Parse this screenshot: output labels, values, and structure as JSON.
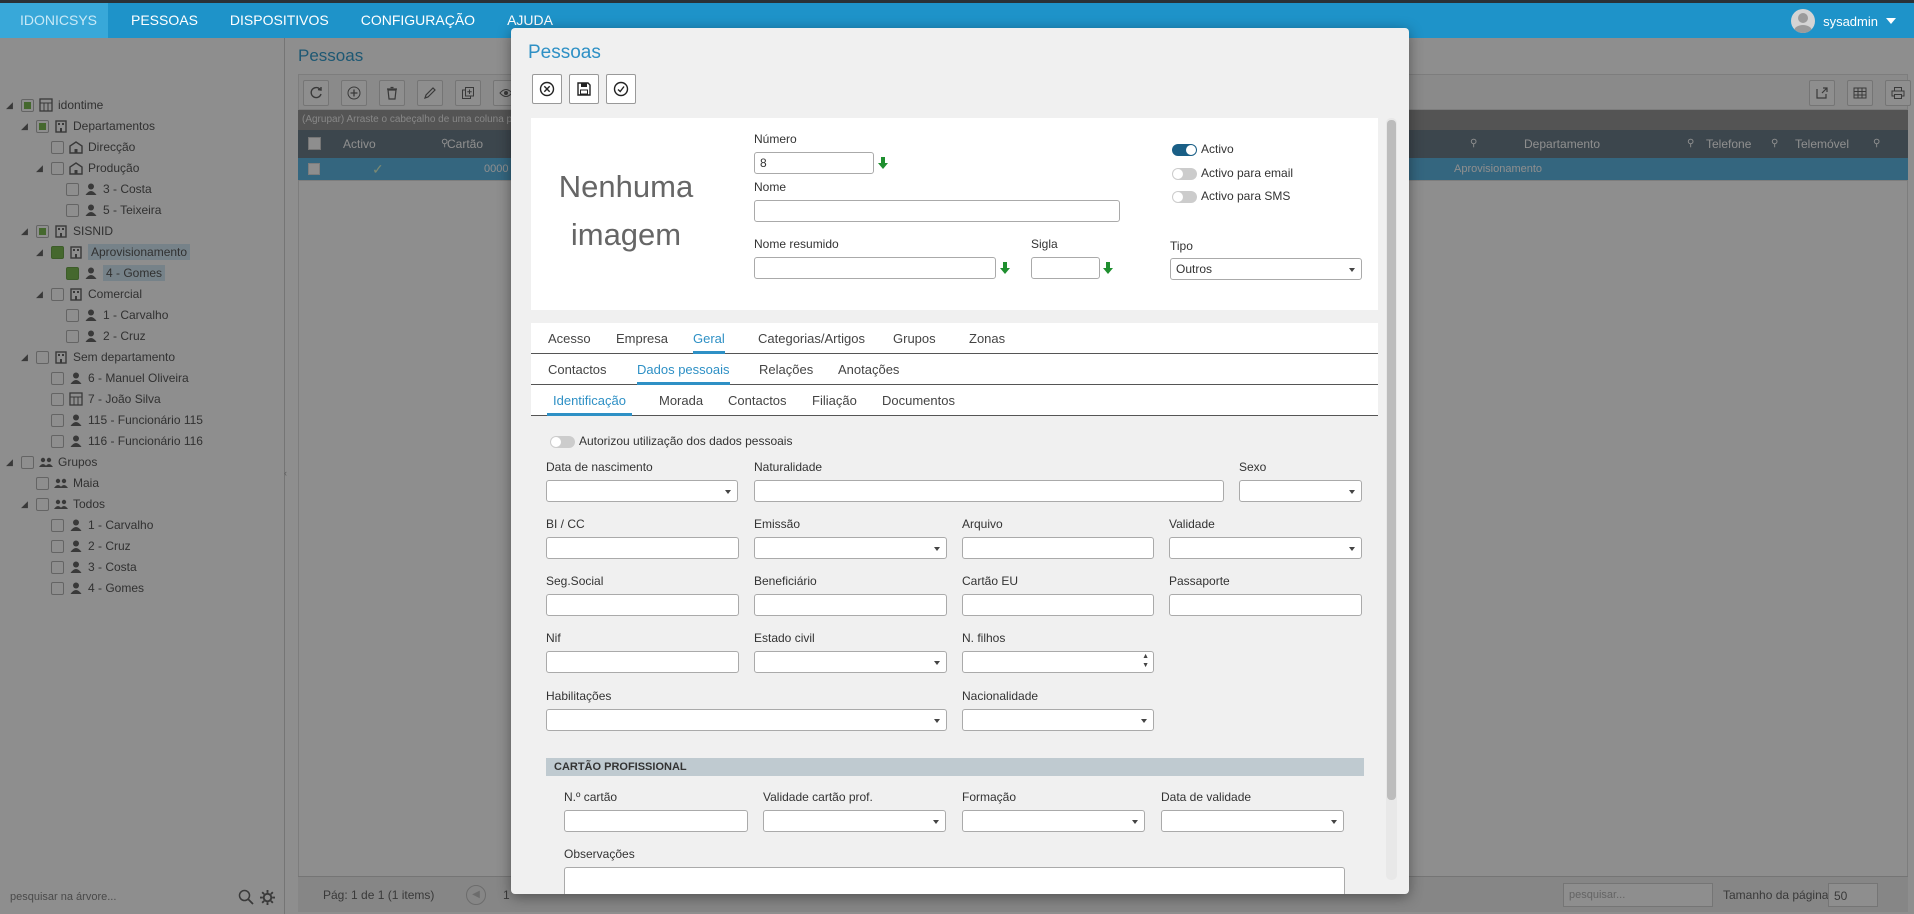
{
  "topbar": {
    "brand": "IDONICSYS",
    "menu": [
      "PESSOAS",
      "DISPOSITIVOS",
      "CONFIGURAÇÃO",
      "AJUDA"
    ],
    "user": "sysadmin"
  },
  "sidebar": {
    "tree": [
      {
        "label": "idontime",
        "level": 0,
        "icon": "org-icon"
      },
      {
        "label": "Departamentos",
        "level": 1,
        "icon": "department-icon"
      },
      {
        "label": "Direcção",
        "level": 2,
        "icon": "building-icon"
      },
      {
        "label": "Produção",
        "level": 2,
        "icon": "building-icon"
      },
      {
        "label": "3 - Costa",
        "level": 3,
        "icon": "person-icon"
      },
      {
        "label": "5 - Teixeira",
        "level": 3,
        "icon": "person-icon"
      },
      {
        "label": "SISNID",
        "level": 1,
        "icon": "department-icon"
      },
      {
        "label": "Aprovisionamento",
        "level": 2,
        "icon": "department-icon"
      },
      {
        "label": "4 - Gomes",
        "level": 3,
        "icon": "person-icon"
      },
      {
        "label": "Comercial",
        "level": 2,
        "icon": "department-icon"
      },
      {
        "label": "1 - Carvalho",
        "level": 3,
        "icon": "person-icon"
      },
      {
        "label": "2 - Cruz",
        "level": 3,
        "icon": "person-icon"
      },
      {
        "label": "Sem departamento",
        "level": 1,
        "icon": "department-icon"
      },
      {
        "label": "6 - Manuel Oliveira",
        "level": 2,
        "icon": "person-icon"
      },
      {
        "label": "7 - João Silva",
        "level": 2,
        "icon": "org-icon"
      },
      {
        "label": "115 - Funcionário 115",
        "level": 2,
        "icon": "person-icon"
      },
      {
        "label": "116 - Funcionário 116",
        "level": 2,
        "icon": "person-icon"
      },
      {
        "label": "Grupos",
        "level": 0,
        "icon": "group-icon"
      },
      {
        "label": "Maia",
        "level": 1,
        "icon": "group-icon"
      },
      {
        "label": "Todos",
        "level": 1,
        "icon": "group-icon"
      },
      {
        "label": "1 - Carvalho",
        "level": 2,
        "icon": "person-icon"
      },
      {
        "label": "2 - Cruz",
        "level": 2,
        "icon": "person-icon"
      },
      {
        "label": "3 - Costa",
        "level": 2,
        "icon": "person-icon"
      },
      {
        "label": "4 - Gomes",
        "level": 2,
        "icon": "person-icon"
      }
    ],
    "search_placeholder": "pesquisar na árvore..."
  },
  "main": {
    "title": "Pessoas",
    "group_hint": "(Agrupar) Arraste o cabeçalho de uma coluna p",
    "columns": [
      "Activo",
      "Cartão",
      "Departamento",
      "Telefone",
      "Telemóvel"
    ],
    "row": {
      "cartao": "0000",
      "departamento": "Aprovisionamento"
    },
    "pager_info": "Pág: 1 de 1 (1 items)",
    "page": "1",
    "search_placeholder": "pesquisar...",
    "page_size_label": "Tamanho da página:",
    "page_size": "50"
  },
  "modal": {
    "title": "Pessoas",
    "no_image": "Nenhuma imagem",
    "numero_label": "Número",
    "numero_value": "8",
    "nome_label": "Nome",
    "nome_resumido_label": "Nome resumido",
    "sigla_label": "Sigla",
    "activo_label": "Activo",
    "activo_email_label": "Activo para email",
    "activo_sms_label": "Activo para SMS",
    "tipo_label": "Tipo",
    "tipo_value": "Outros",
    "tabs1": [
      "Acesso",
      "Empresa",
      "Geral",
      "Categorias/Artigos",
      "Grupos",
      "Zonas"
    ],
    "tabs2": [
      "Contactos",
      "Dados pessoais",
      "Relações",
      "Anotações"
    ],
    "tabs3": [
      "Identificação",
      "Morada",
      "Contactos",
      "Filiação",
      "Documentos"
    ],
    "autorizou_label": "Autorizou utilização dos dados pessoais",
    "fields": {
      "data_nascimento": "Data de nascimento",
      "naturalidade": "Naturalidade",
      "sexo": "Sexo",
      "bi_cc": "BI / CC",
      "emissao": "Emissão",
      "arquivo": "Arquivo",
      "validade": "Validade",
      "seg_social": "Seg.Social",
      "beneficiario": "Beneficiário",
      "cartao_eu": "Cartão EU",
      "passaporte": "Passaporte",
      "nif": "Nif",
      "estado_civil": "Estado civil",
      "n_filhos": "N. filhos",
      "habilitacoes": "Habilitações",
      "nacionalidade": "Nacionalidade"
    },
    "cartao_profissional": {
      "header": "CARTÃO PROFISSIONAL",
      "n_cartao": "N.º cartão",
      "validade_cartao": "Validade cartão prof.",
      "formacao": "Formação",
      "data_validade": "Data de validade",
      "observacoes": "Observações"
    }
  },
  "colors": {
    "accent": "#2e90c5",
    "topbar": "#1e93c9",
    "active_toggle": "#1a5f86",
    "check_green": "#6db33f"
  }
}
